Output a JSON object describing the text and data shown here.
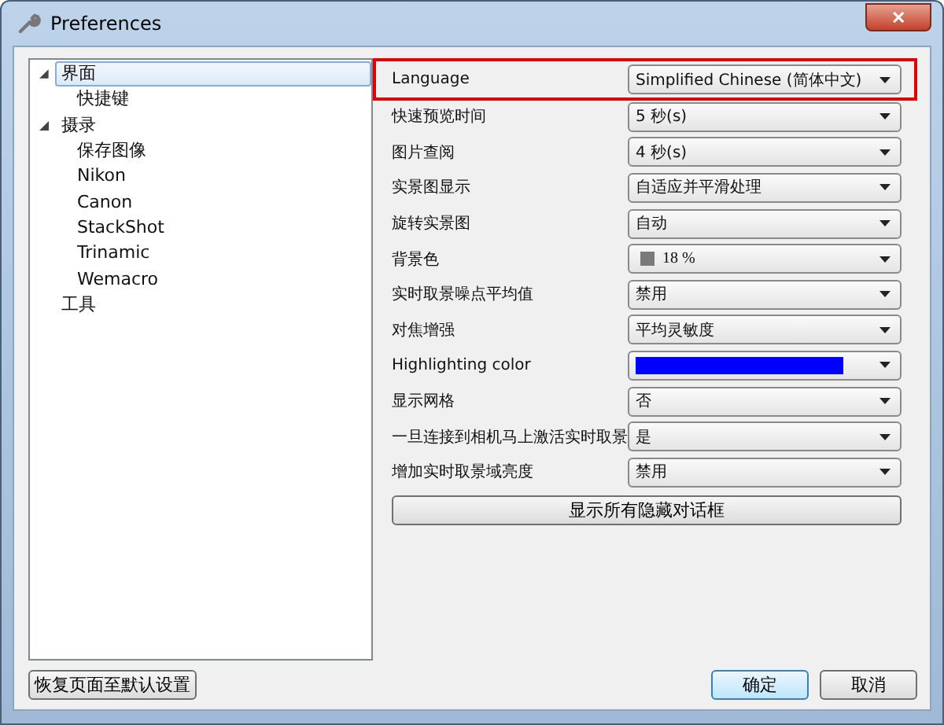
{
  "window": {
    "title": "Preferences",
    "close_label": "✕"
  },
  "tree": [
    {
      "label": "界面",
      "selected": true,
      "expanded": true,
      "children": [
        {
          "label": "快捷键",
          "selected": false
        }
      ]
    },
    {
      "label": "摄录",
      "selected": false,
      "expanded": true,
      "children": [
        {
          "label": "保存图像",
          "selected": false
        },
        {
          "label": "Nikon",
          "selected": false
        },
        {
          "label": "Canon",
          "selected": false
        },
        {
          "label": "StackShot",
          "selected": false
        },
        {
          "label": "Trinamic",
          "selected": false
        },
        {
          "label": "Wemacro",
          "selected": false
        }
      ]
    },
    {
      "label": "工具",
      "selected": false,
      "expanded": false
    }
  ],
  "settings": [
    {
      "kind": "select",
      "label": "Language",
      "value": "Simplified Chinese (简体中文)",
      "highlighted": true
    },
    {
      "kind": "select",
      "label": "快速预览时间",
      "value": "5 秒(s)",
      "highlighted": false
    },
    {
      "kind": "select",
      "label": "图片查阅",
      "value": "4 秒(s)",
      "highlighted": false
    },
    {
      "kind": "select",
      "label": "实景图显示",
      "value": "自适应并平滑处理",
      "highlighted": false
    },
    {
      "kind": "select",
      "label": "旋转实景图",
      "value": "自动",
      "highlighted": false
    },
    {
      "kind": "swatch",
      "label": "背景色",
      "value": "18 %",
      "color": "#7a7a7a",
      "highlighted": false
    },
    {
      "kind": "select",
      "label": "实时取景噪点平均值",
      "value": "禁用",
      "highlighted": false
    },
    {
      "kind": "select",
      "label": "对焦增强",
      "value": "平均灵敏度",
      "highlighted": false
    },
    {
      "kind": "color",
      "label": "Highlighting color",
      "color": "#0000ff",
      "highlighted": false
    },
    {
      "kind": "select",
      "label": "显示网格",
      "value": "否",
      "highlighted": false
    },
    {
      "kind": "select",
      "label": "一旦连接到相机马上激活实时取景",
      "value": "是",
      "highlighted": false
    },
    {
      "kind": "select",
      "label": "增加实时取景域亮度",
      "value": "禁用",
      "highlighted": false
    }
  ],
  "show_dialogs_button": "显示所有隐藏对话框",
  "reset_button": "恢复页面至默认设置",
  "buttons": [
    {
      "label": "确定",
      "default": true
    },
    {
      "label": "取消",
      "default": false
    }
  ]
}
